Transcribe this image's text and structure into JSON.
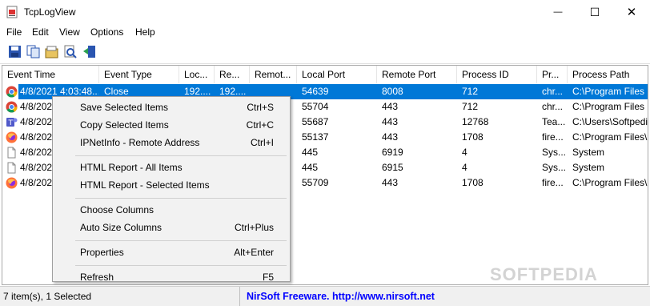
{
  "window": {
    "title": "TcpLogView",
    "minimize_glyph": "—",
    "maximize_glyph": "☐",
    "close_glyph": "✕"
  },
  "menu": [
    "File",
    "Edit",
    "View",
    "Options",
    "Help"
  ],
  "toolbar_icons": [
    "save-icon",
    "copy-icon",
    "properties-icon",
    "find-icon",
    "exit-icon"
  ],
  "columns": [
    "Event Time",
    "Event Type",
    "Loc...",
    "Re...",
    "Remot...",
    "Local Port",
    "Remote Port",
    "Process ID",
    "Pr...",
    "Process Path"
  ],
  "rows": [
    {
      "icon": "chrome-icon",
      "cells": [
        "4/8/2021 4:03:48...",
        "Close",
        "192....",
        "192....",
        "",
        "54639",
        "8008",
        "712",
        "chr...",
        "C:\\Program Files (x"
      ],
      "selected": true
    },
    {
      "icon": "chrome-icon",
      "cells": [
        "4/8/202",
        "",
        "",
        "",
        "",
        "55704",
        "443",
        "712",
        "chr...",
        "C:\\Program Files (x"
      ],
      "selected": false
    },
    {
      "icon": "teams-icon",
      "cells": [
        "4/8/202",
        "",
        "",
        "",
        "",
        "55687",
        "443",
        "12768",
        "Tea...",
        "C:\\Users\\Softpedia"
      ],
      "selected": false
    },
    {
      "icon": "firefox-icon",
      "cells": [
        "4/8/202",
        "",
        "",
        "",
        "",
        "55137",
        "443",
        "1708",
        "fire...",
        "C:\\Program Files\\M"
      ],
      "selected": false
    },
    {
      "icon": "file-icon",
      "cells": [
        "4/8/202",
        "",
        "",
        "",
        "",
        "445",
        "6919",
        "4",
        "Sys...",
        "System"
      ],
      "selected": false
    },
    {
      "icon": "file-icon",
      "cells": [
        "4/8/202",
        "",
        "",
        "",
        "",
        "445",
        "6915",
        "4",
        "Sys...",
        "System"
      ],
      "selected": false
    },
    {
      "icon": "firefox-icon",
      "cells": [
        "4/8/202",
        "",
        "",
        "",
        "",
        "55709",
        "443",
        "1708",
        "fire...",
        "C:\\Program Files\\M"
      ],
      "selected": false
    }
  ],
  "context_menu": [
    {
      "label": "Save Selected Items",
      "shortcut": "Ctrl+S"
    },
    {
      "label": "Copy Selected Items",
      "shortcut": "Ctrl+C"
    },
    {
      "label": "IPNetInfo - Remote Address",
      "shortcut": "Ctrl+I"
    },
    {
      "separator": true
    },
    {
      "label": "HTML Report - All Items",
      "shortcut": ""
    },
    {
      "label": "HTML Report - Selected Items",
      "shortcut": ""
    },
    {
      "separator": true
    },
    {
      "label": "Choose Columns",
      "shortcut": ""
    },
    {
      "label": "Auto Size Columns",
      "shortcut": "Ctrl+Plus"
    },
    {
      "separator": true
    },
    {
      "label": "Properties",
      "shortcut": "Alt+Enter"
    },
    {
      "separator": true
    },
    {
      "label": "Refresh",
      "shortcut": "F5"
    }
  ],
  "status": {
    "left": "7 item(s), 1 Selected",
    "right": "NirSoft Freeware.  http://www.nirsoft.net"
  },
  "watermark": "SOFTPEDIA",
  "colors": {
    "selection": "#0078d7",
    "link": "#0000ff"
  }
}
